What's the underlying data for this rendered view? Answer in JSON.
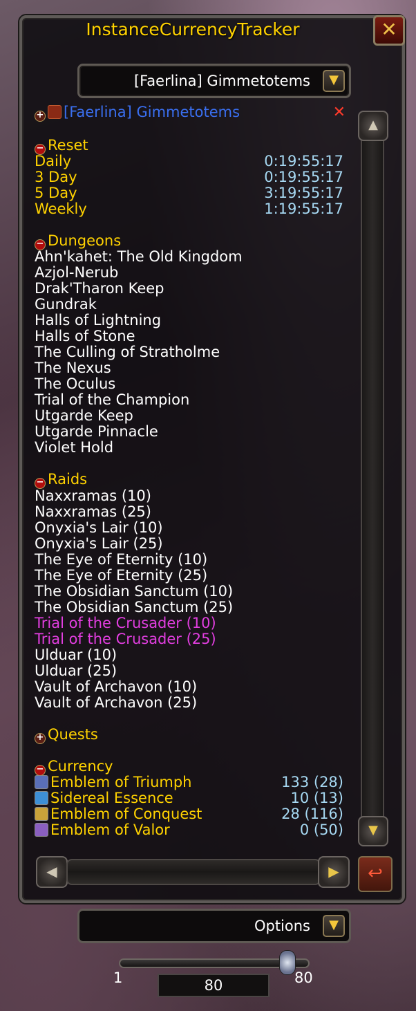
{
  "window": {
    "title": "InstanceCurrencyTracker",
    "close_glyph": "✕"
  },
  "character_dropdown": {
    "selected": "[Faerlina] Gimmetotems",
    "arrow_glyph": "▼"
  },
  "character_header": {
    "toggle": "+",
    "name": "[Faerlina] Gimmetotems",
    "remove_icon": "close-icon",
    "remove_glyph": "✕"
  },
  "reset": {
    "toggle": "−",
    "title": "Reset",
    "items": [
      {
        "label": "Daily",
        "value": "0:19:55:17"
      },
      {
        "label": "3 Day",
        "value": "0:19:55:17"
      },
      {
        "label": "5 Day",
        "value": "3:19:55:17"
      },
      {
        "label": "Weekly",
        "value": "1:19:55:17"
      }
    ]
  },
  "dungeons": {
    "toggle": "−",
    "title": "Dungeons",
    "items": [
      "Ahn'kahet: The Old Kingdom",
      "Azjol-Nerub",
      "Drak'Tharon Keep",
      "Gundrak",
      "Halls of Lightning",
      "Halls of Stone",
      "The Culling of Stratholme",
      "The Nexus",
      "The Oculus",
      "Trial of the Champion",
      "Utgarde Keep",
      "Utgarde Pinnacle",
      "Violet Hold"
    ]
  },
  "raids": {
    "toggle": "−",
    "title": "Raids",
    "items": [
      {
        "name": "Naxxramas (10)",
        "color": "#ffffff"
      },
      {
        "name": "Naxxramas (25)",
        "color": "#ffffff"
      },
      {
        "name": "Onyxia's Lair (10)",
        "color": "#ffffff"
      },
      {
        "name": "Onyxia's Lair (25)",
        "color": "#ffffff"
      },
      {
        "name": "The Eye of Eternity (10)",
        "color": "#ffffff"
      },
      {
        "name": "The Eye of Eternity (25)",
        "color": "#ffffff"
      },
      {
        "name": "The Obsidian Sanctum (10)",
        "color": "#ffffff"
      },
      {
        "name": "The Obsidian Sanctum (25)",
        "color": "#ffffff"
      },
      {
        "name": "Trial of the Crusader (10)",
        "color": "#e23ee0"
      },
      {
        "name": "Trial of the Crusader (25)",
        "color": "#e23ee0"
      },
      {
        "name": "Ulduar (10)",
        "color": "#ffffff"
      },
      {
        "name": "Ulduar (25)",
        "color": "#ffffff"
      },
      {
        "name": "Vault of Archavon (10)",
        "color": "#ffffff"
      },
      {
        "name": "Vault of Archavon (25)",
        "color": "#ffffff"
      }
    ]
  },
  "quests": {
    "toggle": "+",
    "title": "Quests"
  },
  "currency": {
    "toggle": "−",
    "title": "Currency",
    "items": [
      {
        "name": "Emblem of Triumph",
        "value": "133 (28)",
        "icon": "emblem-triumph-icon",
        "icon_color": "#5a6fb8"
      },
      {
        "name": "Sidereal Essence",
        "value": "10 (13)",
        "icon": "sidereal-essence-icon",
        "icon_color": "#3d8fd6"
      },
      {
        "name": "Emblem of Conquest",
        "value": "28 (116)",
        "icon": "emblem-conquest-icon",
        "icon_color": "#c9a23a"
      },
      {
        "name": "Emblem of Valor",
        "value": "0 (50)",
        "icon": "emblem-valor-icon",
        "icon_color": "#8a5fc0"
      }
    ]
  },
  "scrollbar": {
    "up_glyph": "▲",
    "down_glyph": "▼",
    "left_glyph": "◀",
    "right_glyph": "▶"
  },
  "corner_button": {
    "icon": "undo-arrow-icon",
    "glyph": "↩"
  },
  "options_dropdown": {
    "selected": "Options",
    "arrow_glyph": "▼"
  },
  "slider": {
    "min_label": "1",
    "max_label": "80",
    "value": "80",
    "fraction": 1.0
  }
}
